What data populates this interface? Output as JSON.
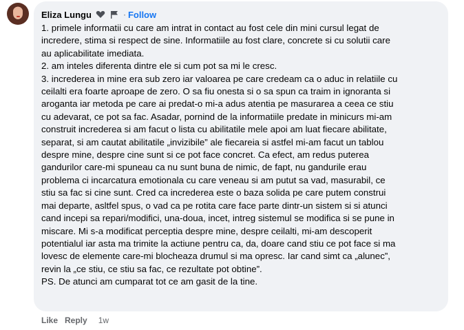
{
  "comment": {
    "author": "Eliza Lungu",
    "badges": [
      "heart-hands-icon",
      "flag-icon"
    ],
    "separator": "·",
    "follow_label": "Follow",
    "lines": [
      "1. primele informatii cu care am intrat in contact au fost cele din mini cursul legat de",
      "incredere, stima si respect de sine. Informatiile au fost clare, concrete si cu solutii care",
      "au aplicabilitate imediata.",
      "2. am inteles diferenta dintre ele si cum pot sa mi le cresc.",
      "3. increderea in mine era sub zero iar valoarea pe care credeam ca o aduc in relatiile cu",
      "ceilalti era foarte aproape de zero. O sa fiu onesta si o sa spun ca traim in ignoranta si",
      "aroganta iar metoda pe care ai predat-o mi-a adus atentia pe masurarea a ceea ce stiu",
      "cu adevarat, ce pot sa fac. Asadar, pornind de la informatiile predate in minicurs mi-am",
      "construit increderea si am facut o lista cu abilitatile mele apoi am luat fiecare abilitate,",
      "separat, si am cautat abilitatile „invizibile” ale fiecareia si astfel mi-am facut un tablou",
      "despre mine, despre cine sunt si ce pot face concret. Ca efect, am redus puterea",
      "gandurilor care-mi spuneau ca nu sunt buna de nimic, de fapt, nu gandurile erau",
      "problema ci incarcatura emotionala cu care veneau si am putut sa vad, masurabil, ce",
      "stiu sa fac si cine sunt. Cred ca increderea este o baza solida pe care putem construi",
      "mai departe, asltfel spus, o vad ca pe rotita care face parte dintr-un sistem si si atunci",
      "cand incepi sa repari/modifici, una-doua, incet, intreg sistemul se modifica si se pune in",
      "miscare. Mi s-a modificat perceptia despre mine, despre ceilalti, mi-am descoperit",
      "potentialul iar asta ma trimite la actiune pentru ca, da, doare cand stiu ce pot face si ma",
      "lovesc de elemente care-mi blocheaza drumul si ma opresc. Iar cand simt ca „alunec”,",
      "revin la „ce stiu, ce stiu sa fac, ce rezultate pot obtine”.",
      "PS. De atunci am cumparat tot ce am gasit de la tine."
    ]
  },
  "actions": {
    "like_label": "Like",
    "reply_label": "Reply",
    "timestamp": "1w"
  }
}
